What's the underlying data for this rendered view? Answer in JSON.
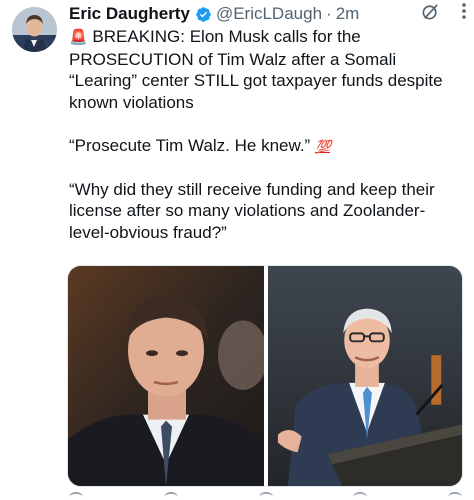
{
  "post": {
    "author": {
      "display_name": "Eric Daugherty",
      "handle": "@EricLDaugh",
      "time": "2m"
    },
    "separator": "·",
    "paragraphs": [
      {
        "emoji": "🚨",
        "text": " BREAKING: Elon Musk calls for the PROSECUTION of Tim Walz after a Somali “Learing” center STILL got taxpayer funds despite known violations"
      },
      {
        "text": "“Prosecute Tim Walz. He knew.” ",
        "emoji_end": "💯"
      },
      {
        "text": "“Why did they still receive funding and keep their license after so many violations and Zoolander-level-obvious fraud?”"
      }
    ],
    "media": [
      {
        "name": "photo-elon-musk"
      },
      {
        "name": "photo-tim-walz"
      }
    ]
  },
  "colors": {
    "text": "#0f1419",
    "secondary": "#536471",
    "verified": "#1d9bf0",
    "hundred": "#e0202a"
  },
  "icons": [
    "verified-badge-icon",
    "grok-icon",
    "more-icon"
  ]
}
